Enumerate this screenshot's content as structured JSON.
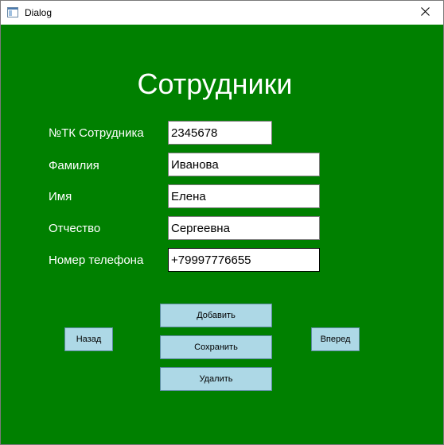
{
  "window": {
    "title": "Dialog"
  },
  "colors": {
    "background": "#008000",
    "button": "#add8e6",
    "text": "#ffffff"
  },
  "form": {
    "heading": "Сотрудники",
    "fields": [
      {
        "label": "№ТК Сотрудника",
        "value": "2345678"
      },
      {
        "label": "Фамилия",
        "value": "Иванова"
      },
      {
        "label": "Имя",
        "value": "Елена"
      },
      {
        "label": "Отчество",
        "value": "Сергеевна"
      },
      {
        "label": "Номер телефона",
        "value": "+79997776655"
      }
    ]
  },
  "buttons": {
    "back": "Назад",
    "add": "Добавить",
    "save": "Сохранить",
    "delete": "Удалить",
    "forward": "Вперед"
  }
}
